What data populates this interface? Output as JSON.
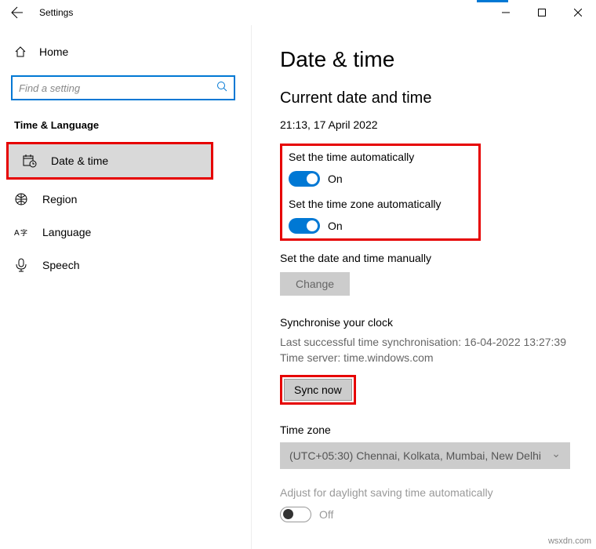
{
  "window": {
    "title": "Settings"
  },
  "sidebar": {
    "home_label": "Home",
    "search_placeholder": "Find a setting",
    "category": "Time & Language",
    "items": [
      {
        "label": "Date & time"
      },
      {
        "label": "Region"
      },
      {
        "label": "Language"
      },
      {
        "label": "Speech"
      }
    ]
  },
  "main": {
    "heading": "Date & time",
    "subheading": "Current date and time",
    "current_datetime": "21:13, 17 April 2022",
    "auto_time_label": "Set the time automatically",
    "auto_time_state": "On",
    "auto_tz_label": "Set the time zone automatically",
    "auto_tz_state": "On",
    "manual_label": "Set the date and time manually",
    "change_button": "Change",
    "sync_heading": "Synchronise your clock",
    "sync_last": "Last successful time synchronisation: 16-04-2022 13:27:39",
    "sync_server": "Time server: time.windows.com",
    "sync_button": "Sync now",
    "tz_heading": "Time zone",
    "tz_value": "(UTC+05:30) Chennai, Kolkata, Mumbai, New Delhi",
    "dst_label": "Adjust for daylight saving time automatically",
    "dst_state": "Off"
  },
  "watermark": "wsxdn.com"
}
